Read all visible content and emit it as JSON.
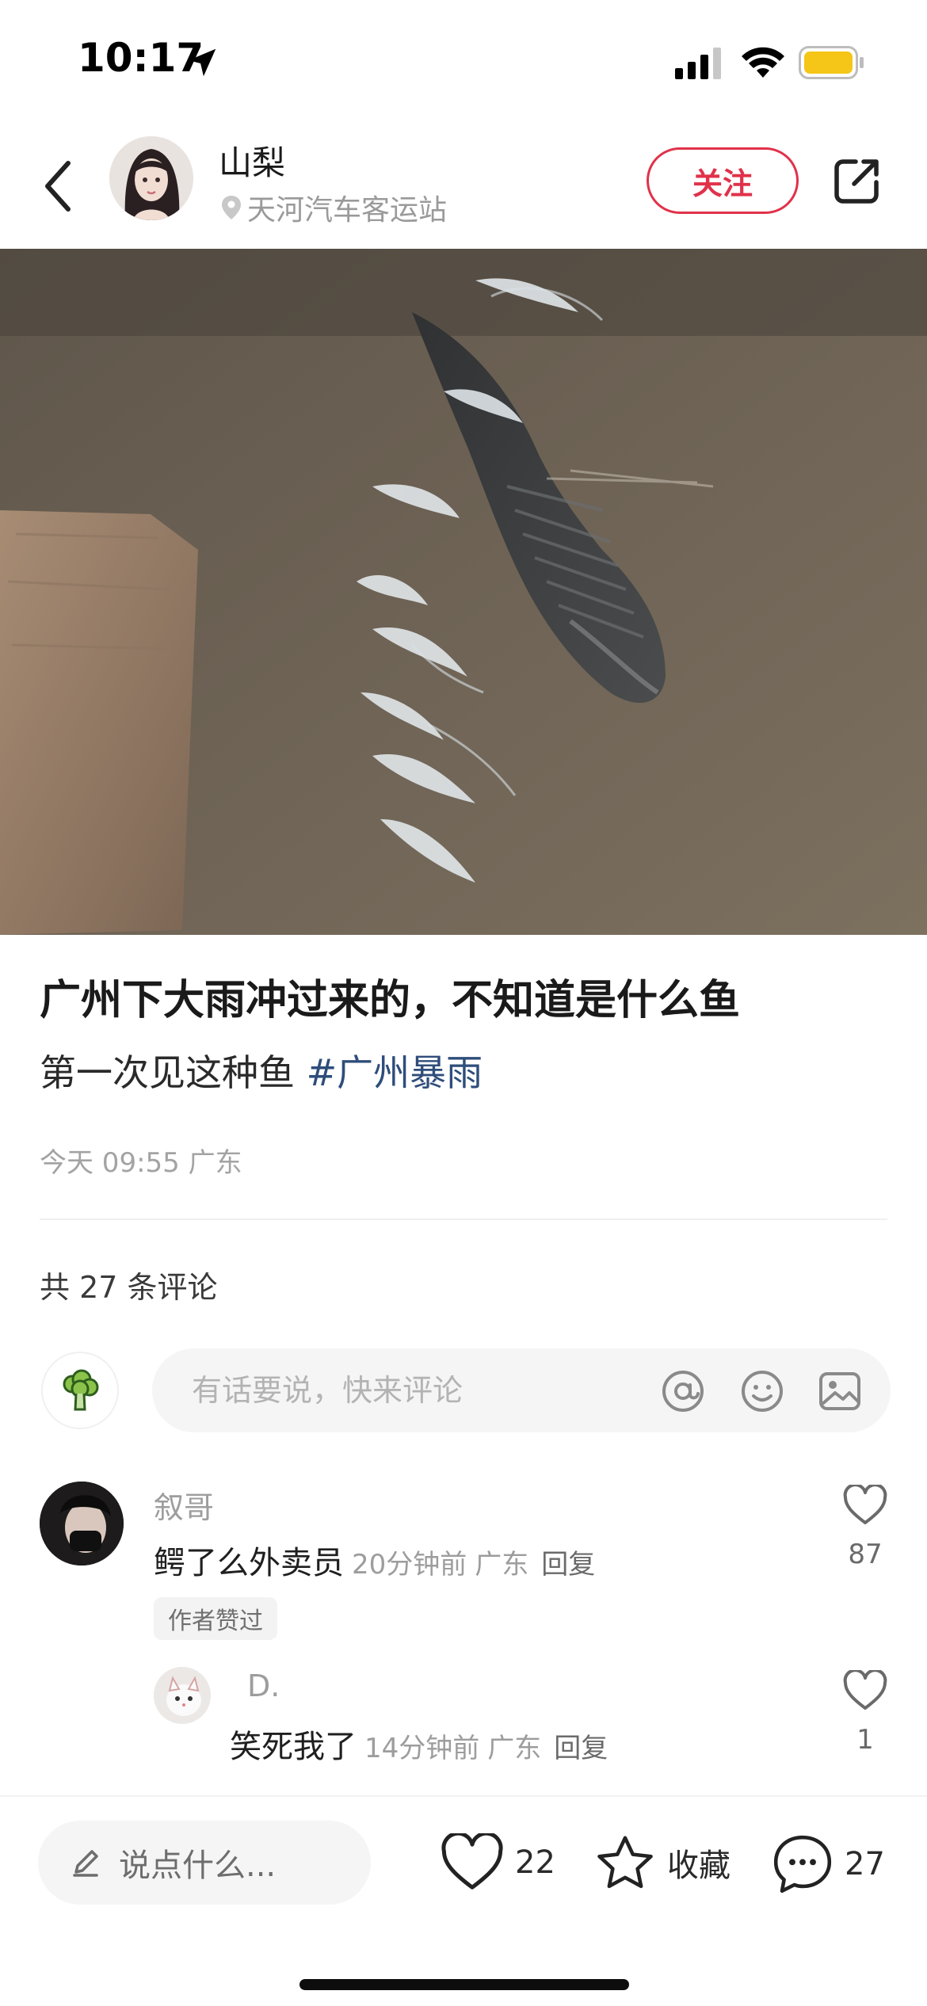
{
  "status_bar": {
    "time": "10:17"
  },
  "header": {
    "author_name": "山梨",
    "location": "天河汽车客运站",
    "follow_label": "关注"
  },
  "post": {
    "title": "广州下大雨冲过来的，不知道是什么鱼",
    "body_text": "第一次见这种鱼 ",
    "hashtag": "#广州暴雨",
    "meta": "今天 09:55 广东"
  },
  "comments_section": {
    "count_label": "共 27 条评论",
    "input_placeholder": "有话要说，快来评论"
  },
  "comments": [
    {
      "name": "叙哥",
      "text": "鳄了么外卖员",
      "time": "20分钟前",
      "region": "广东",
      "reply_label": "回复",
      "likes": "87",
      "badge": "作者赞过"
    },
    {
      "name": "D.",
      "text": "笑死我了",
      "time": "14分钟前",
      "region": "广东",
      "reply_label": "回复",
      "likes": "1"
    }
  ],
  "bottom_bar": {
    "say_placeholder": "说点什么...",
    "likes": "22",
    "collect_label": "收藏",
    "comments": "27"
  },
  "colors": {
    "accent": "#e0324a",
    "hashtag": "#2e4d7a",
    "battery": "#f5c518"
  },
  "icons": [
    "location-arrow-icon",
    "signal-icon",
    "wifi-icon",
    "battery-icon",
    "back-icon",
    "pin-icon",
    "share-icon",
    "at-icon",
    "emoji-icon",
    "image-icon",
    "heart-icon",
    "pencil-icon",
    "star-icon",
    "comment-bubble-icon"
  ]
}
